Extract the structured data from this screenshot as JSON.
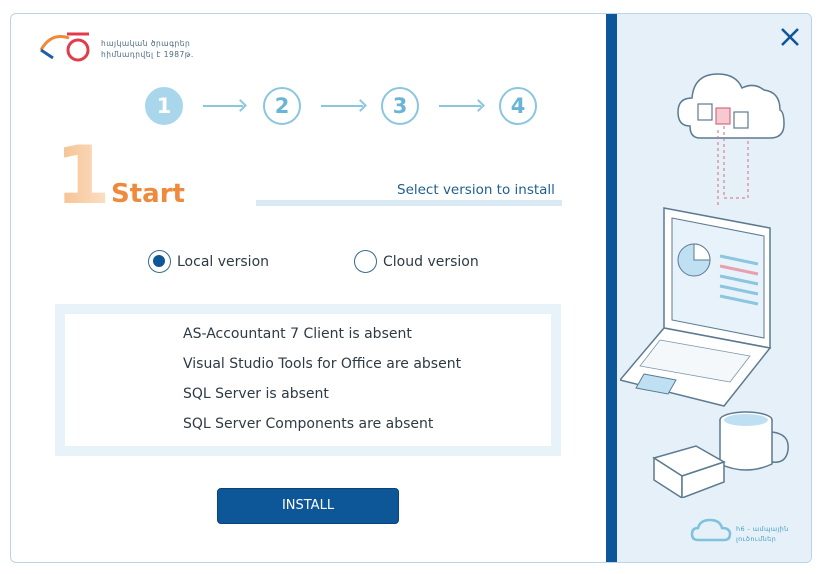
{
  "brand": {
    "tagline_line1": "հայկական ծրագրեր",
    "tagline_line2": "հիմնադրվել է 1987թ."
  },
  "steps": [
    {
      "label": "1",
      "active": true
    },
    {
      "label": "2",
      "active": false
    },
    {
      "label": "3",
      "active": false
    },
    {
      "label": "4",
      "active": false
    }
  ],
  "step_header": {
    "number": "1",
    "title": "Start",
    "subtitle": "Select version to install"
  },
  "version_options": [
    {
      "label": "Local version",
      "selected": true
    },
    {
      "label": "Cloud version",
      "selected": false
    }
  ],
  "status_lines": [
    "AS-Accountant 7 Client is absent",
    "Visual Studio Tools for Office are absent",
    "SQL Server is absent",
    "SQL Server Components are absent"
  ],
  "install_button": {
    "label": "INSTALL"
  },
  "sidebar": {
    "footer_line1": "ամպային",
    "footer_line2": "լուծումներ",
    "footer_prefix": "հ6 -"
  },
  "colors": {
    "accent_blue": "#0d5697",
    "accent_orange": "#ef8a3c",
    "light_blue": "#8bc6e0",
    "sidebar_bg": "#e6f0f8"
  }
}
